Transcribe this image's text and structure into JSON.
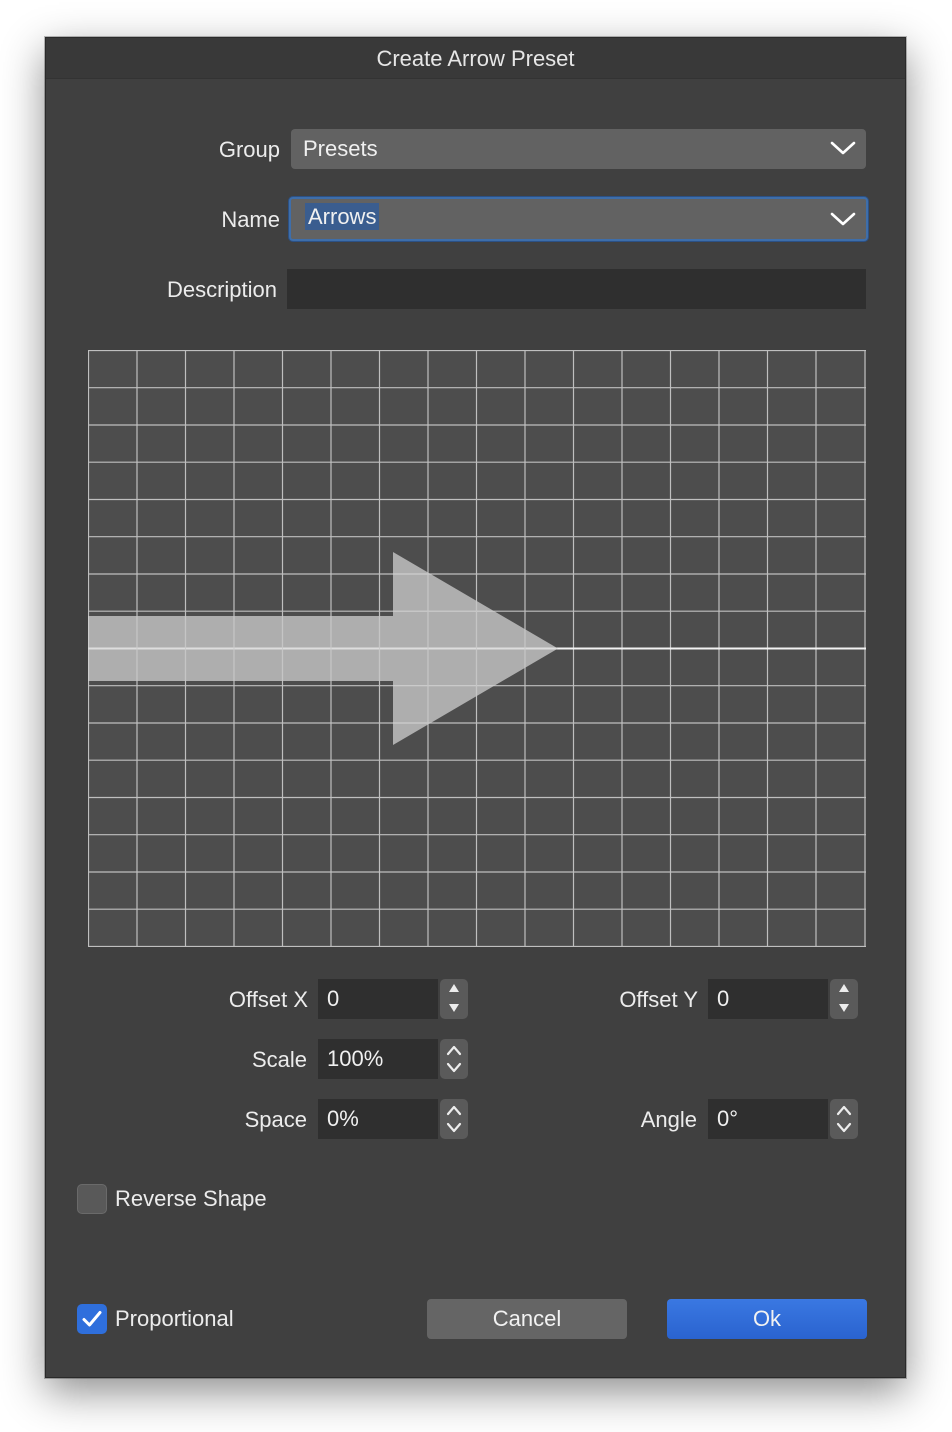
{
  "window": {
    "title": "Create Arrow Preset"
  },
  "form": {
    "group_label": "Group",
    "group_value": "Presets",
    "name_label": "Name",
    "name_value": "Arrows",
    "description_label": "Description",
    "description_value": ""
  },
  "preview": {
    "grid_columns": 16,
    "grid_rows": 16,
    "shape": "arrow-right"
  },
  "params": {
    "offset_x_label": "Offset X",
    "offset_x_value": "0",
    "offset_y_label": "Offset Y",
    "offset_y_value": "0",
    "scale_label": "Scale",
    "scale_value": "100%",
    "space_label": "Space",
    "space_value": "0%",
    "angle_label": "Angle",
    "angle_value": "0°"
  },
  "options": {
    "reverse_shape_label": "Reverse Shape",
    "reverse_shape_checked": false,
    "proportional_label": "Proportional",
    "proportional_checked": true
  },
  "buttons": {
    "cancel": "Cancel",
    "ok": "Ok"
  },
  "colors": {
    "accent": "#2f6fdc",
    "window_bg": "#404040",
    "field_bg": "#2f2f2f"
  },
  "icons": [
    "chevron-down-icon",
    "stepper-arrows-icon",
    "checkmark-icon"
  ]
}
